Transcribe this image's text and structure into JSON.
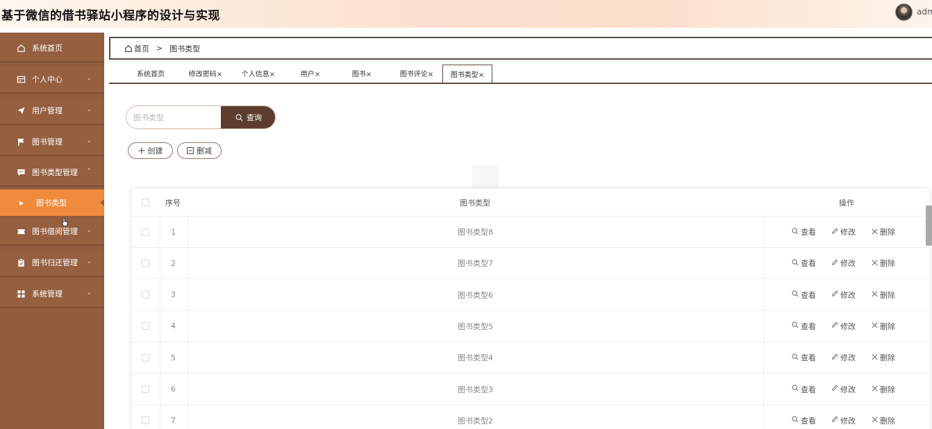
{
  "header": {
    "title": "基于微信的借书驿站小程序的设计与实现",
    "user": "adm"
  },
  "sidebar": {
    "items": [
      {
        "label": "系统首页",
        "icon": "home-icon",
        "arrow": ""
      },
      {
        "label": "个人中心",
        "icon": "card-icon",
        "arrow": "⌄"
      },
      {
        "label": "用户管理",
        "icon": "send-icon",
        "arrow": "⌄"
      },
      {
        "label": "图书管理",
        "icon": "flag-icon",
        "arrow": "⌄"
      },
      {
        "label": "图书类型管理",
        "icon": "message-icon",
        "arrow": "⌃"
      },
      {
        "label": "图书借阅管理",
        "icon": "ticket-icon",
        "arrow": "⌄"
      },
      {
        "label": "图书归还管理",
        "icon": "clipboard-icon",
        "arrow": "⌄"
      },
      {
        "label": "系统管理",
        "icon": "grid-icon",
        "arrow": "⌄"
      }
    ],
    "submenu": {
      "label": "图书类型"
    }
  },
  "breadcrumb": {
    "home": "首页",
    "separator": ">",
    "current": "图书类型"
  },
  "tabs": [
    {
      "label": "系统首页",
      "active": false
    },
    {
      "label": "修改密码×",
      "active": false
    },
    {
      "label": "个人信息×",
      "active": false
    },
    {
      "label": "用户×",
      "active": false
    },
    {
      "label": "图书×",
      "active": false
    },
    {
      "label": "图书评论×",
      "active": false
    },
    {
      "label": "图书类型×",
      "active": true
    }
  ],
  "search": {
    "placeholder": "图书类型",
    "value": "",
    "button": "查询"
  },
  "actions": {
    "create": "创建",
    "delete": "删减"
  },
  "table": {
    "headers": {
      "index": "序号",
      "type": "图书类型",
      "ops": "操作"
    },
    "rows": [
      {
        "index": "1",
        "type": "图书类型8"
      },
      {
        "index": "2",
        "type": "图书类型7"
      },
      {
        "index": "3",
        "type": "图书类型6"
      },
      {
        "index": "4",
        "type": "图书类型5"
      },
      {
        "index": "5",
        "type": "图书类型4"
      },
      {
        "index": "6",
        "type": "图书类型3"
      },
      {
        "index": "7",
        "type": "图书类型2"
      }
    ],
    "row_actions": {
      "view": "查看",
      "edit": "修改",
      "delete": "删除"
    }
  },
  "colors": {
    "sidebar": "#925d3f",
    "active_submenu": "#f08a3c",
    "primary_button": "#5c3d2e"
  }
}
